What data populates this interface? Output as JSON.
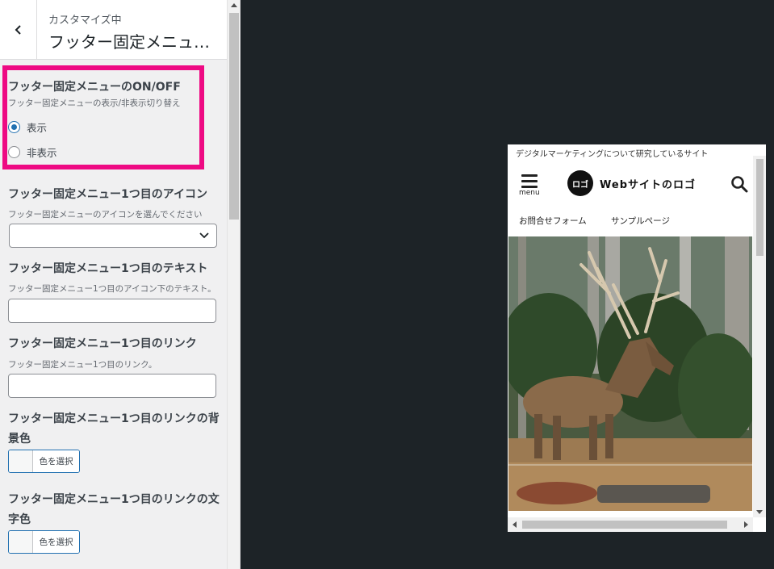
{
  "header": {
    "subtitle": "カスタマイズ中",
    "title": "フッター固定メニュ…"
  },
  "section_onoff": {
    "title": "フッター固定メニューのON/OFF",
    "description": "フッター固定メニューの表示/非表示切り替え",
    "options": [
      {
        "label": "表示",
        "checked": true
      },
      {
        "label": "非表示",
        "checked": false
      }
    ]
  },
  "section_icon": {
    "title": "フッター固定メニュー1つ目のアイコン",
    "description": "フッター固定メニューのアイコンを選んでください",
    "selected": ""
  },
  "section_text": {
    "title": "フッター固定メニュー1つ目のテキスト",
    "description": "フッター固定メニュー1つ目のアイコン下のテキスト。",
    "value": ""
  },
  "section_link": {
    "title": "フッター固定メニュー1つ目のリンク",
    "description": "フッター固定メニュー1つ目のリンク。",
    "value": ""
  },
  "section_bg_color": {
    "title_line1": "フッター固定メニュー1つ目のリンクの背",
    "title_line2": "景色",
    "button_label": "色を選択"
  },
  "section_text_color": {
    "title_line1": "フッター固定メニュー1つ目のリンクの文",
    "title_line2": "字色",
    "button_label": "色を選択"
  },
  "preview": {
    "tagline": "デジタルマーケティングについて研究しているサイト",
    "menu_label": "menu",
    "logo_badge": "ロゴ",
    "logo_text": "Webサイトのロゴ",
    "nav": [
      "お問合せフォーム",
      "サンプルページ"
    ]
  },
  "colors": {
    "highlight": "#ee0a83",
    "accent": "#2271b1",
    "canvas_bg": "#1d2327"
  }
}
